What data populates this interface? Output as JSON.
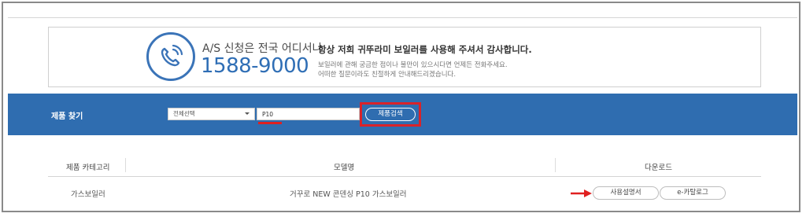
{
  "as_banner": {
    "title": "A/S 신청은 전국 어디서나",
    "phone": "1588-9000",
    "thanks": "항상 저희 귀뚜라미 보일러를 사용해 주셔서 감사합니다.",
    "desc_line1": "보일러에 관해 궁금한 점이나 불만이 있으시다면 언제든 전화주세요.",
    "desc_line2": "어떠한 질문이라도 친절하게 안내해드리겠습니다."
  },
  "search": {
    "label": "제품 찾기",
    "category_selected": "전체선택",
    "query_value": "P10",
    "button_label": "제품검색"
  },
  "table": {
    "headers": [
      "제품 카테고리",
      "모델명",
      "다운로드"
    ],
    "rows": [
      {
        "category": "가스보일러",
        "model": "거꾸로 NEW 콘덴싱 P10 가스보일러",
        "manual_label": "사용설명서",
        "catalog_label": "e-카탈로그"
      }
    ]
  },
  "colors": {
    "accent_blue": "#2f6db0",
    "highlight_red": "#d9232a"
  },
  "icons": {
    "phone": "phone-ringing-icon",
    "annotation_arrow": "red-arrow-icon",
    "select_caret": "chevron-down-icon"
  }
}
